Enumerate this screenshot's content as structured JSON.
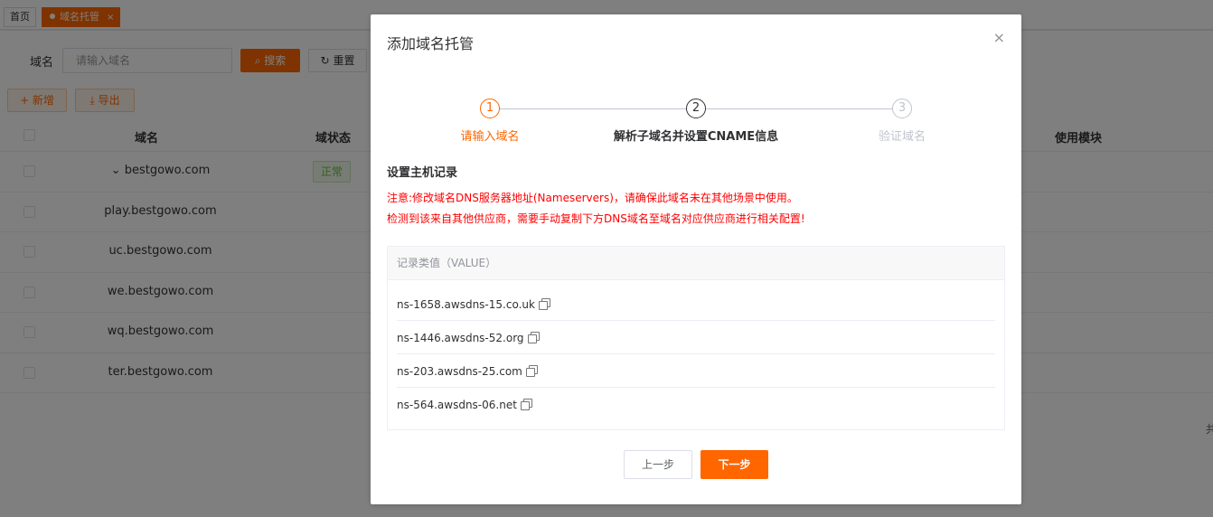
{
  "tabs": {
    "home": "首页",
    "active": "域名托管",
    "close": "×"
  },
  "search": {
    "label": "域名",
    "placeholder": "请输入域名",
    "search_button": "搜索",
    "reset_button": "重置"
  },
  "actions": {
    "add": "+ 新增",
    "export": "导出"
  },
  "table": {
    "headers": {
      "domain": "域名",
      "status": "域状态",
      "module": "使用模块"
    },
    "rows": [
      {
        "domain": "bestgowo.com",
        "expanded": true,
        "status": "正常"
      },
      {
        "domain": "play.bestgowo.com"
      },
      {
        "domain": "uc.bestgowo.com"
      },
      {
        "domain": "we.bestgowo.com"
      },
      {
        "domain": "wq.bestgowo.com"
      },
      {
        "domain": "ter.bestgowo.com"
      }
    ],
    "pager_fragment": "共"
  },
  "dialog": {
    "title": "添加域名托管",
    "close": "×",
    "steps": [
      {
        "number": "1",
        "label": "请输入域名",
        "state": "done"
      },
      {
        "number": "2",
        "label": "解析子域名并设置CNAME信息",
        "state": "current"
      },
      {
        "number": "3",
        "label": "验证域名",
        "state": "pending"
      }
    ],
    "section_title": "设置主机记录",
    "notices": [
      "注意:修改域名DNS服务器地址(Nameservers)，请确保此域名未在其他场景中使用。",
      "检测到该来自其他供应商，需要手动复制下方DNS域名至域名对应供应商进行相关配置!"
    ],
    "value_header": "记录类值（VALUE）",
    "values": [
      "ns-1658.awsdns-15.co.uk",
      "ns-1446.awsdns-52.org",
      "ns-203.awsdns-25.com",
      "ns-564.awsdns-06.net"
    ],
    "prev_button": "上一步",
    "next_button": "下一步"
  },
  "colors": {
    "accent": "#ff6600",
    "warning_text": "#ff0000",
    "status_ok": "#67c23a"
  }
}
